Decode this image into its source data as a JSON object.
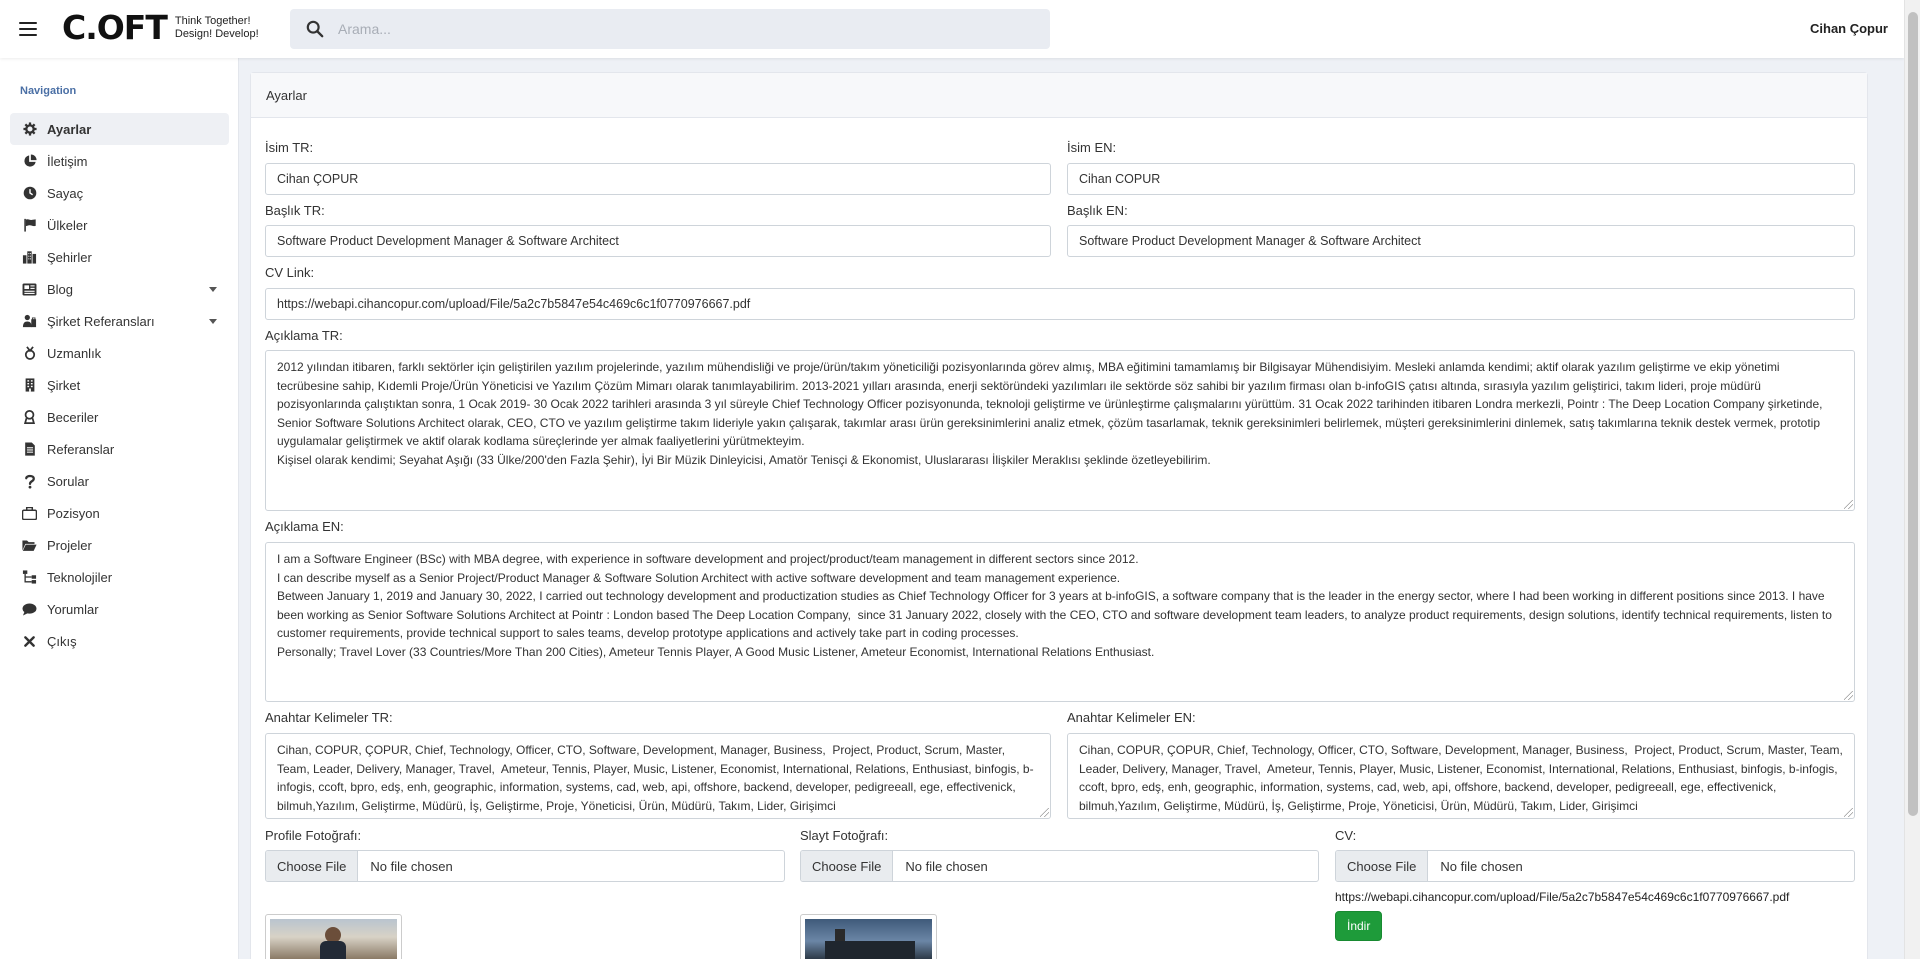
{
  "header": {
    "logo_mark": "C.OFT",
    "logo_tagline_1": "Think Together!",
    "logo_tagline_2": "Design! Develop!",
    "search_placeholder": "Arama...",
    "user_name": "Cihan Çopur"
  },
  "sidebar": {
    "title": "Navigation",
    "items": [
      {
        "label": "Ayarlar",
        "icon": "gear-icon",
        "active": true
      },
      {
        "label": "İletişim",
        "icon": "pie-chart-icon"
      },
      {
        "label": "Sayaç",
        "icon": "clock-icon"
      },
      {
        "label": "Ülkeler",
        "icon": "flag-icon"
      },
      {
        "label": "Şehirler",
        "icon": "city-icon"
      },
      {
        "label": "Blog",
        "icon": "blog-icon",
        "expandable": true
      },
      {
        "label": "Şirket Referansları",
        "icon": "users-icon",
        "expandable": true
      },
      {
        "label": "Uzmanlık",
        "icon": "expertise-icon"
      },
      {
        "label": "Şirket",
        "icon": "building-icon"
      },
      {
        "label": "Beceriler",
        "icon": "award-icon"
      },
      {
        "label": "Referanslar",
        "icon": "document-icon"
      },
      {
        "label": "Sorular",
        "icon": "question-icon"
      },
      {
        "label": "Pozisyon",
        "icon": "briefcase-icon"
      },
      {
        "label": "Projeler",
        "icon": "folder-icon"
      },
      {
        "label": "Teknolojiler",
        "icon": "sitemap-icon"
      },
      {
        "label": "Yorumlar",
        "icon": "comment-icon"
      },
      {
        "label": "Çıkış",
        "icon": "close-icon"
      }
    ]
  },
  "page": {
    "card_title": "Ayarlar",
    "fields": {
      "name_tr_label": "İsim TR:",
      "name_tr_value": "Cihan ÇOPUR",
      "name_en_label": "İsim EN:",
      "name_en_value": "Cihan COPUR",
      "title_tr_label": "Başlık TR:",
      "title_tr_value": "Software Product Development Manager & Software Architect",
      "title_en_label": "Başlık EN:",
      "title_en_value": "Software Product Development Manager & Software Architect",
      "cv_link_label": "CV Link:",
      "cv_link_value": "https://webapi.cihancopur.com/upload/File/5a2c7b5847e54c469c6c1f0770976667.pdf",
      "desc_tr_label": "Açıklama TR:",
      "desc_tr_value": "2012 yılından itibaren, farklı sektörler için geliştirilen yazılım projelerinde, yazılım mühendisliği ve proje/ürün/takım yöneticiliği pozisyonlarında görev almış, MBA eğitimini tamamlamış bir Bilgisayar Mühendisiyim. Mesleki anlamda kendimi; aktif olarak yazılım geliştirme ve ekip yönetimi tecrübesine sahip, Kıdemli Proje/Ürün Yöneticisi ve Yazılım Çözüm Mimarı olarak tanımlayabilirim. 2013-2021 yılları arasında, enerji sektöründeki yazılımları ile sektörde söz sahibi bir yazılım firması olan b-infoGIS çatısı altında, sırasıyla yazılım geliştirici, takım lideri, proje müdürü pozisyonlarında çalıştıktan sonra, 1 Ocak 2019- 30 Ocak 2022 tarihleri arasında 3 yıl süreyle Chief Technology Officer pozisyonunda, teknoloji geliştirme ve ürünleştirme çalışmalarını yürüttüm. 31 Ocak 2022 tarihinden itibaren Londra merkezli, Pointr : The Deep Location Company şirketinde, Senior Software Solutions Architect olarak, CEO, CTO ve yazılım geliştirme takım lideriyle yakın çalışarak, takımlar arası ürün gereksinimlerini analiz etmek, çözüm tasarlamak, teknik gereksinimleri belirlemek, müşteri gereksinimlerini dinlemek, satış takımlarına teknik destek vermek, prototip uygulamalar geliştirmek ve aktif olarak kodlama süreçlerinde yer almak faaliyetlerini yürütmekteyim.\nKişisel olarak kendimi; Seyahat Aşığı (33 Ülke/200'den Fazla Şehir), İyi Bir Müzik Dinleyicisi, Amatör Tenisçi & Ekonomist, Uluslararası İlişkiler Meraklısı şeklinde özetleyebilirim.",
      "desc_en_label": "Açıklama EN:",
      "desc_en_value": "I am a Software Engineer (BSc) with MBA degree, with experience in software development and project/product/team management in different sectors since 2012.\nI can describe myself as a Senior Project/Product Manager & Software Solution Architect with active software development and team management experience.\nBetween January 1, 2019 and January 30, 2022, I carried out technology development and productization studies as Chief Technology Officer for 3 years at b-infoGIS, a software company that is the leader in the energy sector, where I had been working in different positions since 2013. I have been working as Senior Software Solutions Architect at Pointr : London based The Deep Location Company,  since 31 January 2022, closely with the CEO, CTO and software development team leaders, to analyze product requirements, design solutions, identify technical requirements, listen to customer requirements, provide technical support to sales teams, develop prototype applications and actively take part in coding processes.\nPersonally; Travel Lover (33 Countries/More Than 200 Cities), Ameteur Tennis Player, A Good Music Listener, Ameteur Economist, International Relations Enthusiast.",
      "keywords_tr_label": "Anahtar Kelimeler TR:",
      "keywords_tr_value": "Cihan, COPUR, ÇOPUR, Chief, Technology, Officer, CTO, Software, Development, Manager, Business,  Project, Product, Scrum, Master, Team, Leader, Delivery, Manager, Travel,  Ameteur, Tennis, Player, Music, Listener, Economist, International, Relations, Enthusiast, binfogis, b-infogis, ccoft, bpro, edş, enh, geographic, information, systems, cad, web, api, offshore, backend, developer, pedigreeall, ege, effectivenick, bilmuh,Yazılım, Geliştirme, Müdürü, İş, Geliştirme, Proje, Yöneticisi, Ürün, Müdürü, Takım, Lider, Girişimci",
      "keywords_en_label": "Anahtar Kelimeler EN:",
      "keywords_en_value": "Cihan, COPUR, ÇOPUR, Chief, Technology, Officer, CTO, Software, Development, Manager, Business,  Project, Product, Scrum, Master, Team, Leader, Delivery, Manager, Travel,  Ameteur, Tennis, Player, Music, Listener, Economist, International, Relations, Enthusiast, binfogis, b-infogis, ccoft, bpro, edş, enh, geographic, information, systems, cad, web, api, offshore, backend, developer, pedigreeall, ege, effectivenick, bilmuh,Yazılım, Geliştirme, Müdürü, İş, Geliştirme, Proje, Yöneticisi, Ürün, Müdürü, Takım, Lider, Girişimci",
      "profile_photo_label": "Profile Fotoğrafı:",
      "slide_photo_label": "Slayt Fotoğrafı:",
      "cv_label": "CV:",
      "choose_file": "Choose File",
      "no_file": "No file chosen",
      "cv_current_link": "https://webapi.cihancopur.com/upload/File/5a2c7b5847e54c469c6c1f0770976667.pdf",
      "download_button": "İndir"
    }
  }
}
